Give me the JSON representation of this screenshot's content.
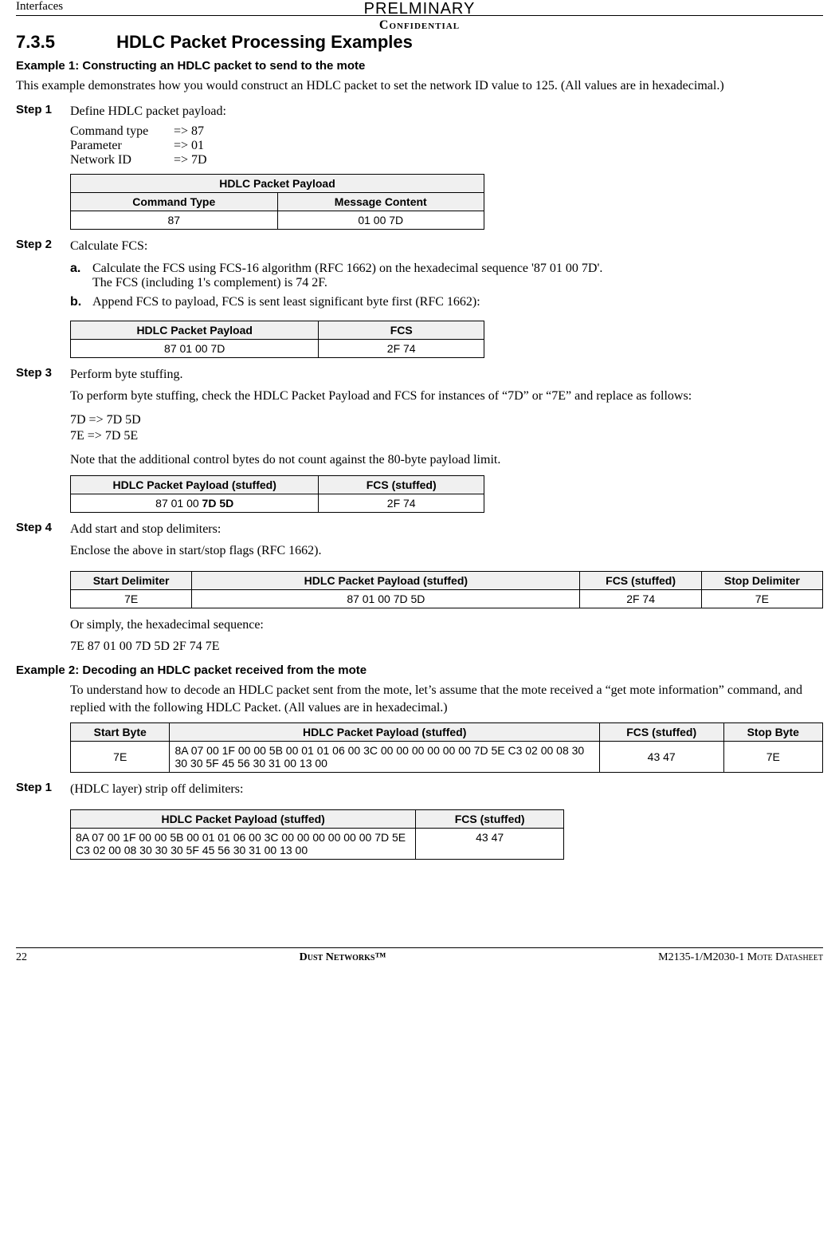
{
  "header": {
    "left": "Interfaces",
    "preliminary": "PRELMINARY",
    "confidential": "Confidential"
  },
  "section": {
    "number": "7.3.5",
    "title": "HDLC Packet Processing Examples"
  },
  "example1": {
    "title": "Example 1: Constructing an HDLC packet to send to the mote",
    "intro": "This example demonstrates how you would construct an HDLC packet to set the network ID value to 125. (All values are in hexadecimal.)"
  },
  "step1": {
    "label": "Step 1",
    "text": "Define HDLC packet payload:",
    "defs": [
      {
        "k": "Command type",
        "v": "=> 87"
      },
      {
        "k": "Parameter",
        "v": "=> 01"
      },
      {
        "k": "Network ID",
        "v": "=> 7D"
      }
    ],
    "table": {
      "caption": "HDLC Packet Payload",
      "h1": "Command Type",
      "h2": "Message Content",
      "c1": "87",
      "c2": "01 00 7D"
    }
  },
  "step2": {
    "label": "Step 2",
    "text": "Calculate FCS:",
    "a": {
      "marker": "a.",
      "line1": "Calculate the FCS using FCS-16 algorithm (RFC 1662) on the hexadecimal sequence '87 01 00 7D'.",
      "line2": "The FCS (including 1's complement) is 74 2F."
    },
    "b": {
      "marker": "b.",
      "text": "Append FCS to payload, FCS is sent least significant byte first (RFC 1662):"
    },
    "table": {
      "h1": "HDLC Packet Payload",
      "h2": "FCS",
      "c1": "87 01 00 7D",
      "c2": "2F 74"
    }
  },
  "step3": {
    "label": "Step 3",
    "text": "Perform byte stuffing.",
    "para": "To perform byte stuffing, check the HDLC Packet Payload and FCS for instances of “7D” or “7E” and replace as follows:",
    "sub1": "7D   => 7D 5D",
    "sub2": "7E   => 7D 5E",
    "note": "Note that the additional control bytes do not count against the 80-byte payload limit.",
    "table": {
      "h1": "HDLC Packet Payload (stuffed)",
      "h2": "FCS (stuffed)",
      "c1a": "87 01 00 ",
      "c1b": "7D 5D",
      "c2": "2F 74"
    }
  },
  "step4": {
    "label": "Step 4",
    "text": "Add start and stop delimiters:",
    "para": "Enclose the above in start/stop flags (RFC 1662).",
    "table": {
      "h1": "Start Delimiter",
      "h2": "HDLC Packet Payload (stuffed)",
      "h3": "FCS (stuffed)",
      "h4": "Stop Delimiter",
      "c1": "7E",
      "c2": "87 01 00 7D 5D",
      "c3": "2F 74",
      "c4": "7E"
    },
    "after1": "Or simply, the hexadecimal sequence:",
    "after2": "7E 87 01 00 7D 5D 2F 74 7E"
  },
  "example2": {
    "title": "Example 2: Decoding an HDLC packet received from the mote",
    "intro": "To understand how to decode an HDLC packet sent from the mote, let’s assume that the mote received a “get mote information” command, and replied with the following HDLC Packet. (All values are in hexadecimal.)",
    "table": {
      "h1": "Start Byte",
      "h2": "HDLC Packet Payload (stuffed)",
      "h3": "FCS (stuffed)",
      "h4": "Stop Byte",
      "c1": "7E",
      "c2": "8A 07 00 1F 00 00 5B 00 01 01 06 00 3C 00 00 00 00 00 00 7D 5E C3 02 00 08 30 30 30 5F 45 56 30 31 00 13 00",
      "c3": "43 47",
      "c4": "7E"
    }
  },
  "step1b": {
    "label": "Step 1",
    "text": "(HDLC layer) strip off delimiters:",
    "table": {
      "h1": "HDLC Packet Payload (stuffed)",
      "h2": "FCS (stuffed)",
      "c1": "8A 07 00 1F 00 00 5B 00 01 01 06 00 3C 00 00 00 00 00 00 7D 5E C3 02 00 08 30 30 30 5F 45 56 30 31 00 13 00",
      "c2": "43 47"
    }
  },
  "footer": {
    "pagenum": "22",
    "center": "Dust Networks™",
    "right": "M2135-1/M2030-1 Mote Datasheet"
  }
}
